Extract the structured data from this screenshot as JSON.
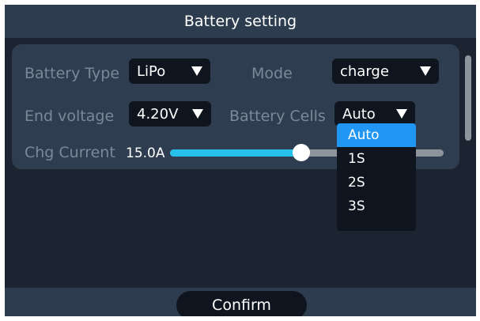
{
  "window": {
    "title": "Battery setting"
  },
  "settings": {
    "battery_type": {
      "label": "Battery Type",
      "value": "LiPo"
    },
    "mode": {
      "label": "Mode",
      "value": "charge"
    },
    "end_voltage": {
      "label": "End voltage",
      "value": "4.20V"
    },
    "battery_cells": {
      "label": "Battery Cells",
      "value": "Auto",
      "options": [
        "Auto",
        "1S",
        "2S",
        "3S"
      ],
      "highlighted": "Auto"
    },
    "charge_current": {
      "label": "Chg Current",
      "value": "15.0A",
      "slider_fraction": 0.48
    }
  },
  "footer": {
    "confirm_label": "Confirm"
  },
  "colors": {
    "title_bar": "#2d3d4f",
    "background": "#1b2430",
    "panel": "#2e3e50",
    "accent": "#27c1eb",
    "selection": "#2196f3"
  }
}
